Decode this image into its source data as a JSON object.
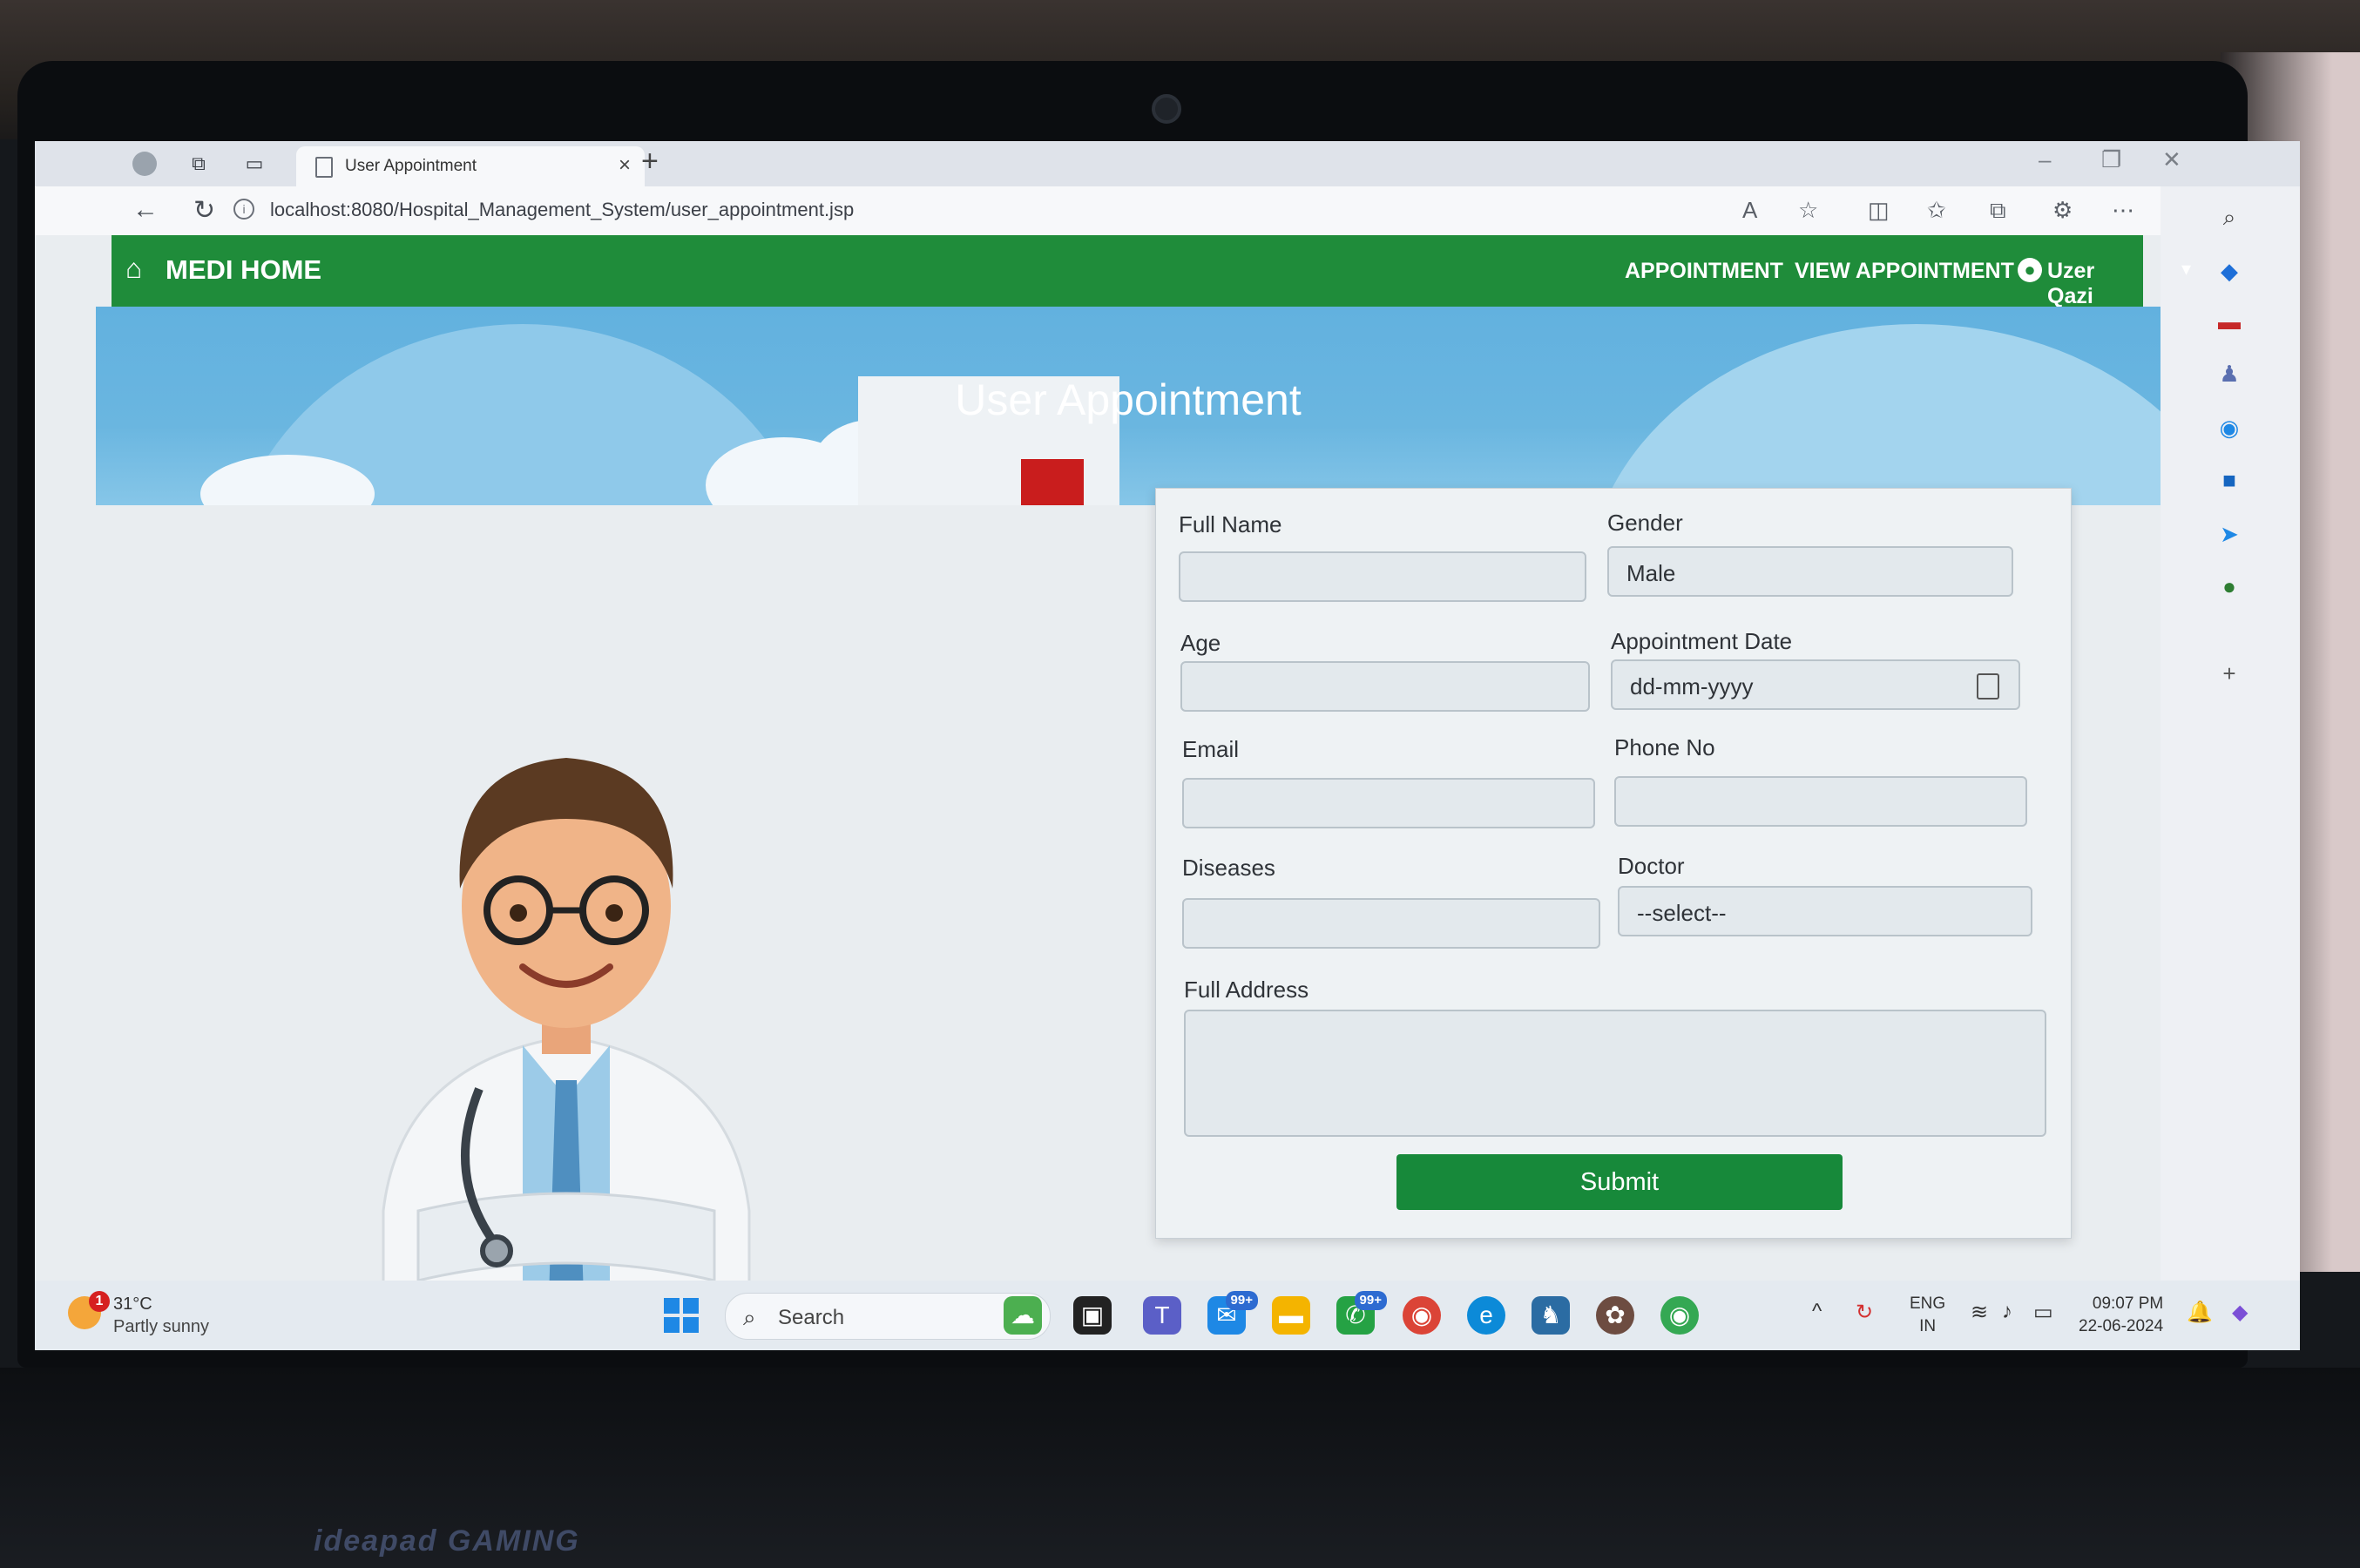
{
  "browser": {
    "tab_title": "User Appointment",
    "tab_close": "×",
    "new_tab": "+",
    "url": "localhost:8080/Hospital_Management_System/user_appointment.jsp",
    "window_controls": [
      "–",
      "❐",
      "✕"
    ]
  },
  "navbar": {
    "brand": "MEDI HOME",
    "links": [
      "APPOINTMENT",
      "VIEW APPOINTMENT"
    ],
    "user": "Uzer Qazi",
    "color": "#1f8c3a"
  },
  "hero": {
    "title": "User Appointment"
  },
  "form": {
    "full_name_label": "Full Name",
    "gender_label": "Gender",
    "gender_value": "Male",
    "age_label": "Age",
    "appointment_date_label": "Appointment Date",
    "appointment_date_placeholder": "dd-mm-yyyy",
    "email_label": "Email",
    "phone_label": "Phone No",
    "diseases_label": "Diseases",
    "doctor_label": "Doctor",
    "doctor_value": "--select--",
    "address_label": "Full Address",
    "submit_label": "Submit",
    "submit_color": "#17893a"
  },
  "taskbar": {
    "weather_badge": "1",
    "temperature": "31°C",
    "condition": "Partly sunny",
    "search_label": "Search",
    "mail_badge": "99+",
    "whatsapp_badge": "99+",
    "lang_top": "ENG",
    "lang_bottom": "IN",
    "time": "09:07 PM",
    "date": "22-06-2024"
  },
  "device": {
    "brand": "ideapad GAMING"
  }
}
